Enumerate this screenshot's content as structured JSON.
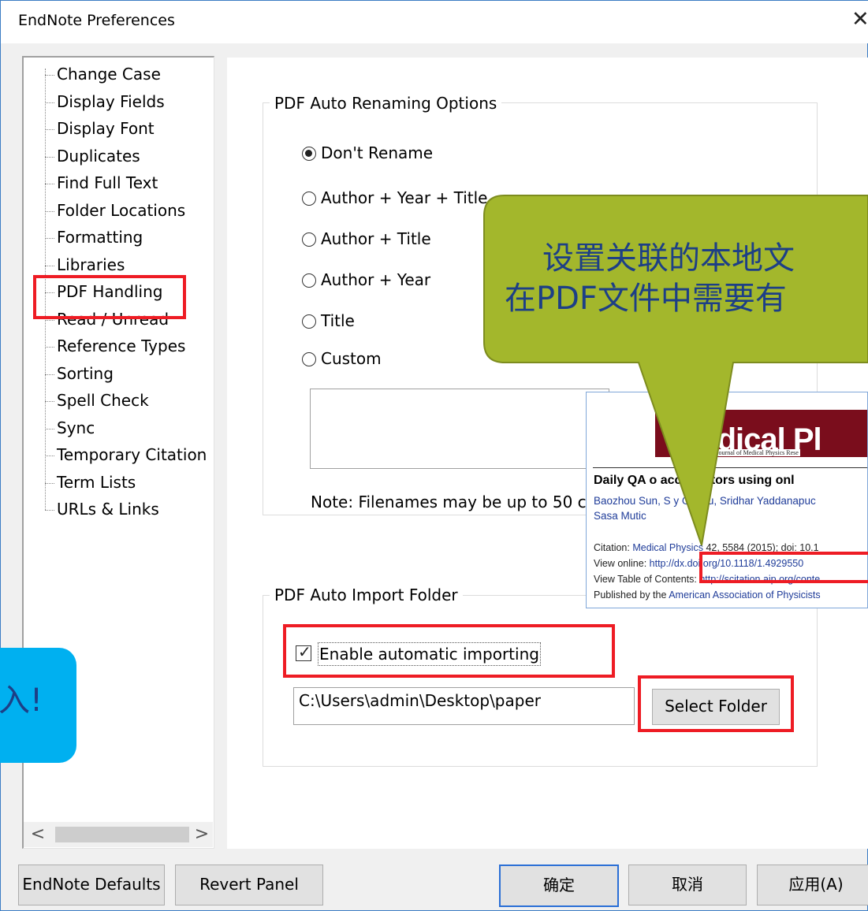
{
  "window": {
    "title": "EndNote Preferences",
    "close_glyph": "✕"
  },
  "sidebar": {
    "items": [
      {
        "label": "Change Case"
      },
      {
        "label": "Display Fields"
      },
      {
        "label": "Display Font"
      },
      {
        "label": "Duplicates"
      },
      {
        "label": "Find Full Text"
      },
      {
        "label": "Folder Locations"
      },
      {
        "label": "Formatting"
      },
      {
        "label": "Libraries"
      },
      {
        "label": "PDF Handling",
        "selected": true
      },
      {
        "label": "Read / Unread"
      },
      {
        "label": "Reference Types"
      },
      {
        "label": "Sorting"
      },
      {
        "label": "Spell Check"
      },
      {
        "label": "Sync"
      },
      {
        "label": "Temporary Citation"
      },
      {
        "label": "Term Lists"
      },
      {
        "label": "URLs & Links"
      }
    ],
    "scroll_left": "<",
    "scroll_right": ">"
  },
  "renaming": {
    "legend": "PDF Auto Renaming Options",
    "options": [
      {
        "label": "Don't Rename",
        "checked": true
      },
      {
        "label": "Author + Year + Title",
        "checked": false
      },
      {
        "label": "Author + Title",
        "checked": false
      },
      {
        "label": "Author + Year",
        "checked": false
      },
      {
        "label": "Title",
        "checked": false
      },
      {
        "label": "Custom",
        "checked": false
      }
    ],
    "note": "Note: Filenames may be up to 50 c"
  },
  "import": {
    "legend": "PDF Auto Import Folder",
    "checkbox_label": "Enable automatic importing",
    "checkbox_checked": true,
    "folder_path": "C:\\Users\\admin\\Desktop\\paper",
    "select_folder_label": "Select Folder"
  },
  "buttons": {
    "defaults": "EndNote Defaults",
    "revert": "Revert Panel",
    "ok": "确定",
    "cancel": "取消",
    "apply": "应用(A)"
  },
  "pdf_preview": {
    "journal_name": "Medical Pl",
    "journal_subtitle": "he International Journal of Medical Physics Rese",
    "title": "Daily QA o         accelerators using onl",
    "authors_line1": "Baozhou Sun, S          y Goddu, Sridhar Yaddanapuc",
    "authors_line2": "Sasa Mutic",
    "citation_prefix": "Citation: ",
    "citation_link": "Medical Physics",
    "citation_rest": " 42, 5584 (2015); doi: 10.1",
    "view_online_prefix": "View online: ",
    "view_online_link": "http://dx.doi.org/10.1118/1.4929550",
    "toc_prefix": "View Table of Contents: ",
    "toc_link": "http://scitation.aip.org/conte",
    "published_prefix": "Published by the ",
    "published_link": "American Association of Physicists"
  },
  "callout": {
    "line1": "设置关联的本地文",
    "line2": "在PDF文件中需要有",
    "color": "#a3b72c"
  },
  "tip": {
    "text": "入!",
    "color": "#00b0f0"
  },
  "accent_colors": {
    "highlight": "#ee1c24",
    "focus": "#2a6fd6"
  }
}
